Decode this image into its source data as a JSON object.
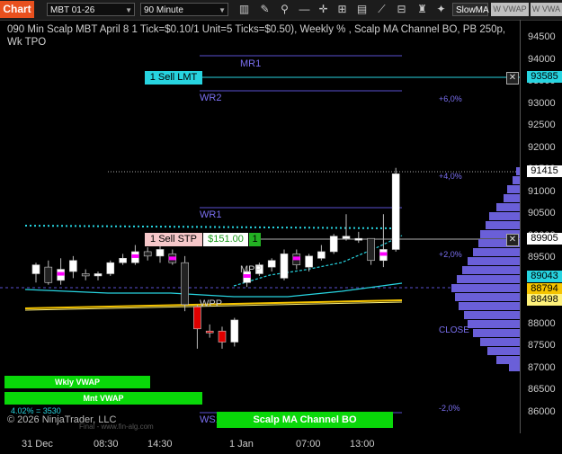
{
  "toolbar": {
    "chart_label": "Chart",
    "instrument": "MBT 01-26",
    "interval": "90 Minute",
    "indicator_select": "SlowMA",
    "btn_vwap": "W VWAP",
    "btn_w_vwa": "W VWA",
    "icons": [
      "bar-chart-icon",
      "pencil-icon",
      "zoom-icon",
      "crosshair-icon",
      "minus-icon",
      "grid-icon",
      "data-box-icon",
      "draw-object-icon",
      "properties-icon",
      "strategy-icon"
    ]
  },
  "chart": {
    "title": "090 Min Scalp MBT April 8 1 Tick=$0.10/1 Unit=5 Ticks=$0.50), Weekly % , Scalp MA Channel BO, PB 250p, Wk TPO",
    "y_ticks": [
      "94500",
      "94000",
      "93500",
      "93000",
      "92500",
      "92000",
      "91500",
      "91000",
      "90500",
      "90000",
      "89500",
      "89000",
      "88500",
      "88000",
      "87500",
      "87000",
      "86500",
      "86000"
    ],
    "x_ticks": [
      "31 Dec",
      "08:30",
      "14:30",
      "1 Jan",
      "07:00",
      "13:00"
    ],
    "price_markers": [
      {
        "label": "93585",
        "color": "#27d4e0"
      },
      {
        "label": "91415",
        "color": "#ffffff"
      },
      {
        "label": "89905",
        "color": "#ffffff"
      },
      {
        "label": "89043",
        "color": "#27d4e0"
      },
      {
        "label": "88794",
        "color": "#f5c400"
      },
      {
        "label": "88498",
        "color": "#fff27a"
      }
    ],
    "levels": {
      "mr1": "MR1",
      "wr2": "WR2",
      "wr1": "WR1",
      "mpp": "MPP",
      "wpp": "WPP",
      "ws1": "WS1",
      "close": "CLOSE"
    },
    "pct_labels": [
      "+6,0%",
      "+4,0%",
      "+2,0%",
      "-2,0%"
    ],
    "orders": {
      "sell_lmt": "1 Sell LMT",
      "sell_stp": "1 Sell STP",
      "pnl": "$151.00",
      "qty": "1"
    },
    "buttons": {
      "wkly_vwap": "Wkly VWAP",
      "mnt_vwap": "Mnt VWAP",
      "scalp_channel": "Scalp MA Channel BO"
    },
    "bottom_stat": "4.02% = 3530",
    "copyright": "© 2026 NinjaTrader, LLC",
    "watermark": "Final - www.fin-alg.com"
  },
  "chart_data": {
    "type": "candlestick",
    "candles": [
      {
        "o": 89150,
        "h": 89400,
        "l": 88950,
        "c": 89350
      },
      {
        "o": 89300,
        "h": 89450,
        "l": 88900,
        "c": 88950
      },
      {
        "o": 89000,
        "h": 89500,
        "l": 88900,
        "c": 89250
      },
      {
        "o": 89200,
        "h": 89550,
        "l": 89050,
        "c": 89450
      },
      {
        "o": 89150,
        "h": 89250,
        "l": 89000,
        "c": 89100
      },
      {
        "o": 89100,
        "h": 89200,
        "l": 89000,
        "c": 89150
      },
      {
        "o": 89150,
        "h": 89450,
        "l": 89100,
        "c": 89400
      },
      {
        "o": 89400,
        "h": 89600,
        "l": 89350,
        "c": 89500
      },
      {
        "o": 89400,
        "h": 89800,
        "l": 89350,
        "c": 89650
      },
      {
        "o": 89650,
        "h": 89750,
        "l": 89450,
        "c": 89550
      },
      {
        "o": 89550,
        "h": 89800,
        "l": 89400,
        "c": 89700
      },
      {
        "o": 89600,
        "h": 89700,
        "l": 89350,
        "c": 89400
      },
      {
        "o": 89400,
        "h": 89550,
        "l": 88300,
        "c": 88450
      },
      {
        "o": 88400,
        "h": 88450,
        "l": 87450,
        "c": 87900
      },
      {
        "o": 87850,
        "h": 88000,
        "l": 87700,
        "c": 87850
      },
      {
        "o": 87850,
        "h": 87950,
        "l": 87450,
        "c": 87600
      },
      {
        "o": 87600,
        "h": 88150,
        "l": 87500,
        "c": 88100
      },
      {
        "o": 88950,
        "h": 89250,
        "l": 88850,
        "c": 89200
      },
      {
        "o": 89150,
        "h": 89400,
        "l": 89100,
        "c": 89350
      },
      {
        "o": 89300,
        "h": 89500,
        "l": 89200,
        "c": 89450
      },
      {
        "o": 89050,
        "h": 89700,
        "l": 89000,
        "c": 89600
      },
      {
        "o": 89600,
        "h": 89700,
        "l": 89250,
        "c": 89350
      },
      {
        "o": 89300,
        "h": 89600,
        "l": 89200,
        "c": 89550
      },
      {
        "o": 89500,
        "h": 89800,
        "l": 89450,
        "c": 89650
      },
      {
        "o": 89650,
        "h": 90050,
        "l": 89600,
        "c": 90000
      },
      {
        "o": 89950,
        "h": 90500,
        "l": 89900,
        "c": 90000
      },
      {
        "o": 89950,
        "h": 90100,
        "l": 89850,
        "c": 89950
      },
      {
        "o": 89950,
        "h": 89950,
        "l": 89350,
        "c": 89450
      },
      {
        "o": 89450,
        "h": 90500,
        "l": 89300,
        "c": 89700
      },
      {
        "o": 89700,
        "h": 91550,
        "l": 89650,
        "c": 91415
      }
    ],
    "current_price": 89905
  }
}
